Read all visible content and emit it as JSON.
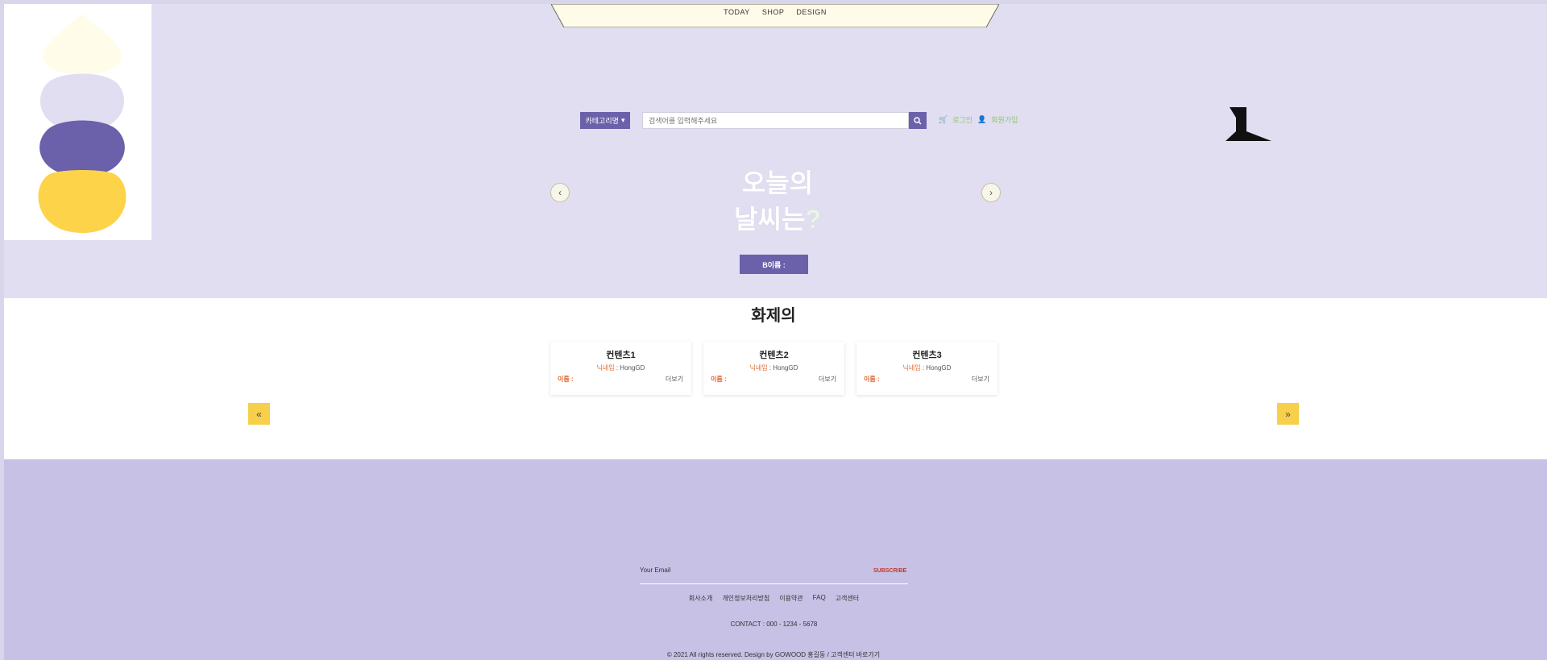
{
  "top_nav": {
    "items": [
      "TODAY",
      "SHOP",
      "DESIGN"
    ]
  },
  "search": {
    "category_label": "카테고리명",
    "placeholder": "검색어를 입력해주세요"
  },
  "utility": {
    "items": [
      "로그인",
      "회원가입"
    ]
  },
  "hero": {
    "title_line1": "오늘의",
    "title_line2": "날씨는",
    "title_mark": "?",
    "button_label": "B이름 :"
  },
  "topics": {
    "title": "화제의",
    "cards": [
      {
        "title": "컨텐츠1",
        "nick_label": "닉네임",
        "nick_value": " : HongGD",
        "name_label": "이름 :",
        "more": "더보기"
      },
      {
        "title": "컨텐츠2",
        "nick_label": "닉네임",
        "nick_value": " : HongGD",
        "name_label": "이름 :",
        "more": "더보기"
      },
      {
        "title": "컨텐츠3",
        "nick_label": "닉네임",
        "nick_value": " : HongGD",
        "name_label": "이름 :",
        "more": "더보기"
      }
    ],
    "prev_icon": "«",
    "next_icon": "»"
  },
  "footer": {
    "email_label": "Your Email",
    "subscribe_label": "SUBSCRIBE",
    "links": [
      "회사소개",
      "개인정보처리방침",
      "이용약관",
      "FAQ",
      "고객센터"
    ],
    "contact": "CONTACT : 000 - 1234 - 5678",
    "copyright": "© 2021 All rights reserved. Design by GOWOOD 홍길동 / 고객센터 바로가기"
  },
  "colors": {
    "hero_bg": "#e0def0",
    "accent_purple": "#6a61aa",
    "accent_yellow": "#f7cf4a",
    "footer_bg": "#c6c1e5",
    "highlight_orange": "#e0652c"
  },
  "icons": {
    "search": "search-icon",
    "cart": "cart-icon",
    "user": "user-icon",
    "arrow_left": "chevron-left-icon",
    "arrow_right": "chevron-right-icon"
  }
}
